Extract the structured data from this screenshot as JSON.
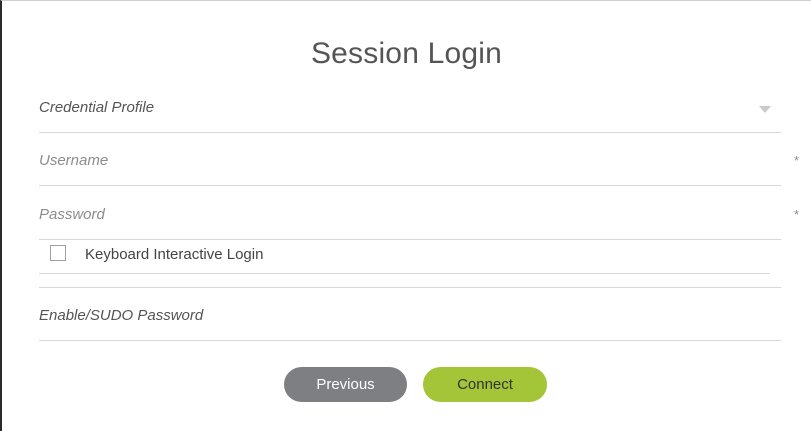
{
  "dialog": {
    "title": "Session Login"
  },
  "form": {
    "credential_profile": {
      "label": "Credential Profile"
    },
    "username": {
      "placeholder": "Username",
      "required_mark": "*"
    },
    "password": {
      "placeholder": "Password",
      "required_mark": "*"
    },
    "keyboard_interactive": {
      "label": "Keyboard Interactive Login",
      "checked": false
    },
    "sudo_password": {
      "placeholder": "Enable/SUDO Password"
    }
  },
  "buttons": {
    "previous": "Previous",
    "connect": "Connect"
  },
  "colors": {
    "previous_button": "#7d7f82",
    "connect_button": "#a3c537"
  }
}
